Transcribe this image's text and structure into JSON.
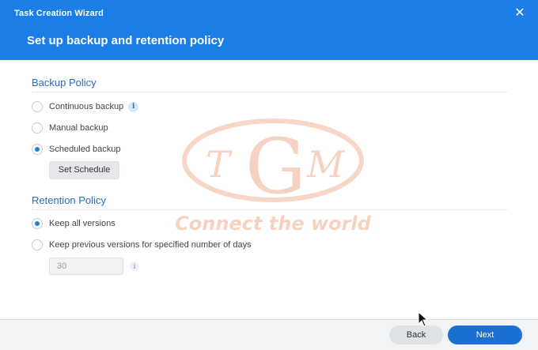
{
  "window": {
    "title": "Task Creation Wizard",
    "close_icon": "close-icon",
    "accent_color": "#1a7ee6"
  },
  "page_title": "Set up backup and retention policy",
  "backup_policy": {
    "title": "Backup Policy",
    "options": [
      {
        "label": "Continuous backup",
        "selected": false,
        "has_info": true
      },
      {
        "label": "Manual backup",
        "selected": false
      },
      {
        "label": "Scheduled backup",
        "selected": true
      }
    ],
    "set_schedule_label": "Set Schedule"
  },
  "retention_policy": {
    "title": "Retention Policy",
    "options": [
      {
        "label": "Keep all versions",
        "selected": true
      },
      {
        "label": "Keep previous versions for specified number of days",
        "selected": false
      }
    ],
    "days_value": "30"
  },
  "watermark": {
    "letters": [
      "T",
      "G",
      "M"
    ],
    "tagline": "Connect the world"
  },
  "footer": {
    "back_label": "Back",
    "next_label": "Next"
  }
}
